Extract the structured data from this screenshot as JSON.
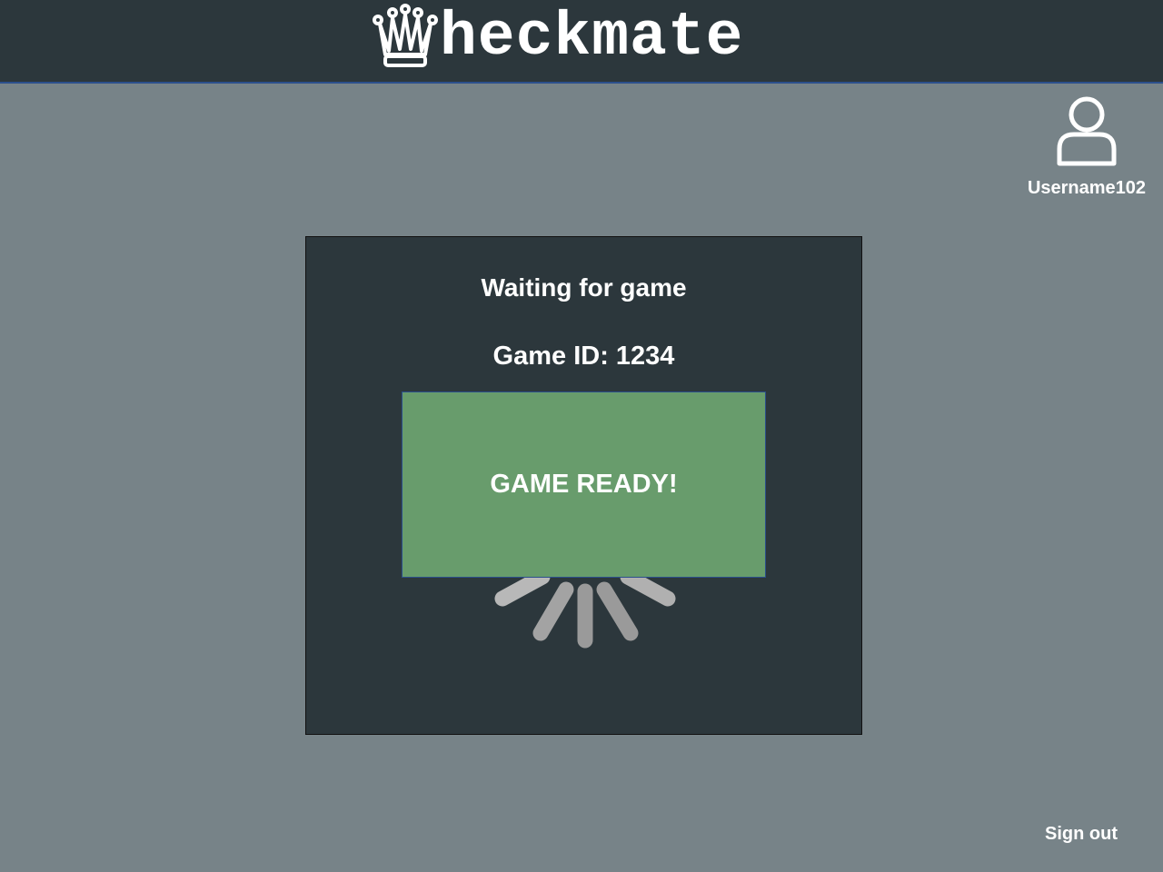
{
  "header": {
    "logo_text": "heckmate",
    "logo_icon": "queen-crown-icon"
  },
  "user": {
    "avatar_icon": "user-avatar-icon",
    "username": "Username102"
  },
  "panel": {
    "title": "Waiting for game",
    "game_id": "Game ID: 1234",
    "ready_button_label": "GAME READY!",
    "spinner_icon": "loading-spinner-icon"
  },
  "footer": {
    "signout_label": "Sign out"
  },
  "colors": {
    "background": "#778388",
    "header": "#2c373c",
    "panel": "#2c373c",
    "ready_button": "#689c6c",
    "accent_border": "#2b4f8c"
  }
}
